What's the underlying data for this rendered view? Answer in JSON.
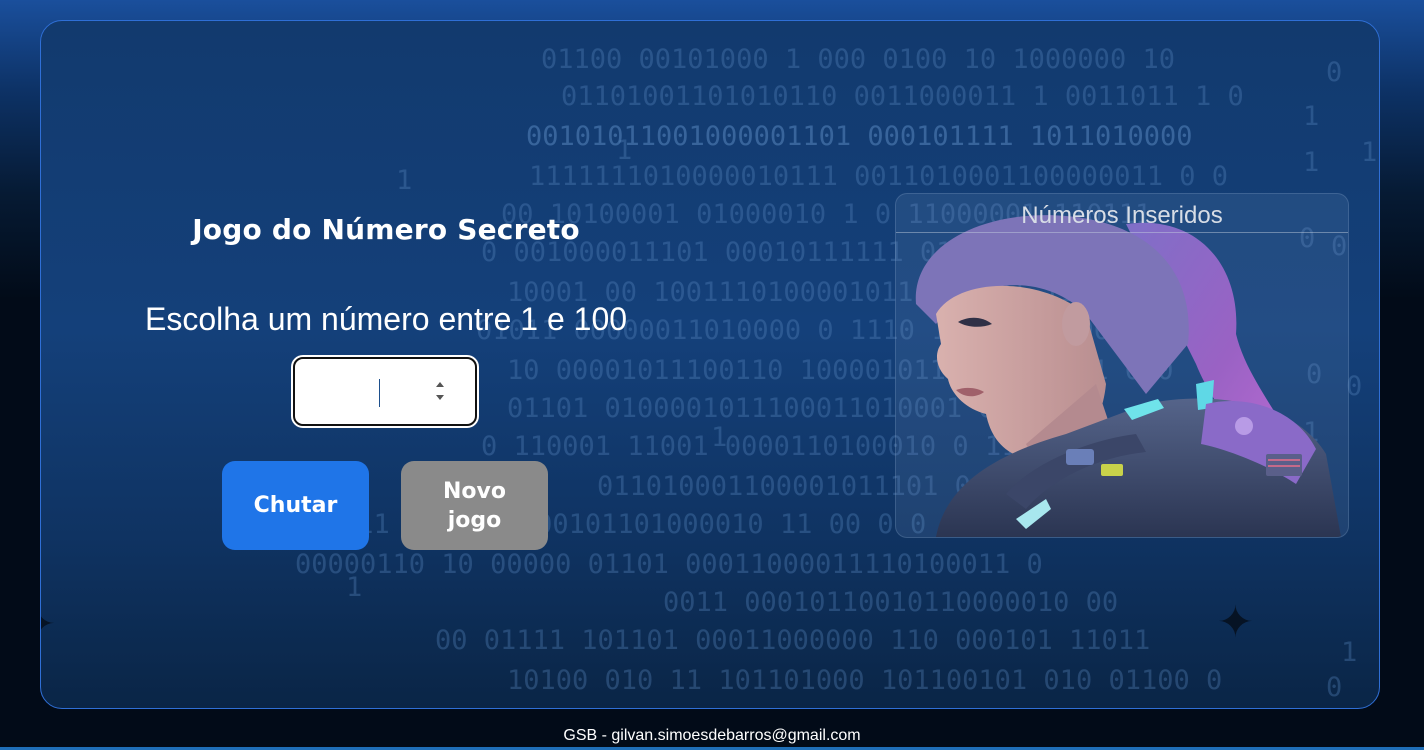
{
  "app": {
    "title": "Jogo do Número Secreto",
    "subtitle": "Escolha um número entre 1 e 100"
  },
  "guess_input": {
    "value": "",
    "placeholder": ""
  },
  "buttons": {
    "guess_label": "Chutar",
    "new_game_label": "Novo jogo"
  },
  "panel": {
    "title": "Números Inseridos",
    "entries": []
  },
  "footer": {
    "text": "GSB - gilvan.simoesdebarros@gmail.com"
  },
  "colors": {
    "guess_button": "#1f75e8",
    "new_game_button": "#8a8a8a",
    "container_border": "#2f6fd6"
  },
  "icons": {
    "spinner": "number-spinner-icon",
    "decoration": "sparkle-icon"
  }
}
